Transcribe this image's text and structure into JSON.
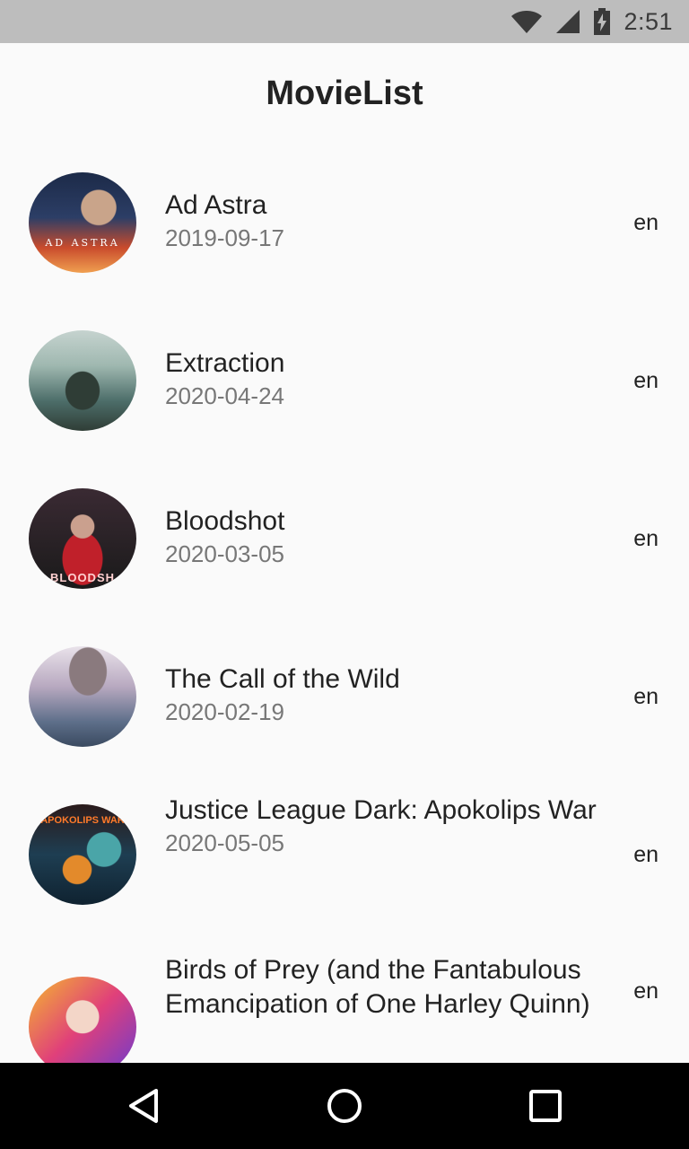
{
  "status_bar": {
    "time": "2:51",
    "icons": [
      "wifi-icon",
      "cell-signal-icon",
      "battery-charging-icon"
    ]
  },
  "app_bar": {
    "title": "MovieList"
  },
  "movies": [
    {
      "title": "Ad Astra",
      "date": "2019-09-17",
      "lang": "en",
      "poster_text": "AD ASTRA",
      "colors": [
        "#1c2a48",
        "#c94b2c",
        "#f0a050"
      ]
    },
    {
      "title": "Extraction",
      "date": "2020-04-24",
      "lang": "en",
      "poster_text": "",
      "colors": [
        "#4d6e6a",
        "#9fb8b0",
        "#2f3d36"
      ]
    },
    {
      "title": "Bloodshot",
      "date": "2020-03-05",
      "lang": "en",
      "poster_text": "BLOODSH",
      "colors": [
        "#1a1a1a",
        "#c0202a",
        "#3a2a33"
      ]
    },
    {
      "title": "The Call of the Wild",
      "date": "2020-02-19",
      "lang": "en",
      "poster_text": "",
      "colors": [
        "#e9e2ea",
        "#5e6f8a",
        "#b8a9c0"
      ]
    },
    {
      "title": "Justice League Dark: Apokolips War",
      "date": "2020-05-05",
      "lang": "en",
      "poster_text": "APOKOLIPS WAR",
      "colors": [
        "#1e3e52",
        "#e38a2b",
        "#4aa5a8"
      ]
    },
    {
      "title": "Birds of Prey (and the Fantabulous Emancipation of One Harley Quinn)",
      "date": "",
      "lang": "en",
      "poster_text": "",
      "colors": [
        "#f5b82e",
        "#e0407a",
        "#6a3bd0"
      ]
    }
  ],
  "nav_bar": {
    "buttons": [
      "back-icon",
      "home-icon",
      "recents-icon"
    ]
  }
}
